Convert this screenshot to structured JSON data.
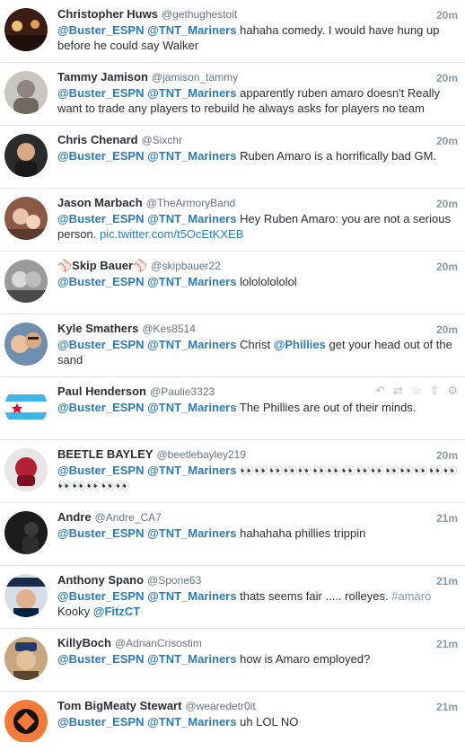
{
  "tweets": [
    {
      "name": "Christopher Huws",
      "handle": "@gethughestoit",
      "time": "20m",
      "m1": "@Buster_ESPN",
      "m2": "@TNT_Mariners",
      "text": "hahaha comedy. I would have hung up before he could say Walker"
    },
    {
      "name": "Tammy Jamison",
      "handle": "@jamison_tammy",
      "time": "20m",
      "m1": "@Buster_ESPN",
      "m2": "@TNT_Mariners",
      "text": "apparently ruben amaro doesn't Really want to trade any players to rebuild he always asks for players no team"
    },
    {
      "name": "Chris Chenard",
      "handle": "@Sixchr",
      "time": "20m",
      "m1": "@Buster_ESPN",
      "m2": "@TNT_Mariners",
      "text": "Ruben Amaro is a horrifically bad GM."
    },
    {
      "name": "Jason Marbach",
      "handle": "@TheArmoryBand",
      "time": "20m",
      "m1": "@Buster_ESPN",
      "m2": "@TNT_Mariners",
      "text": "Hey Ruben Amaro: you are not a serious person.",
      "link": "pic.twitter.com/t5OcEtKXEB"
    },
    {
      "name": "⚾Skip Bauer⚾",
      "handle": "@skipbauer22",
      "time": "20m",
      "m1": "@Buster_ESPN",
      "m2": "@TNT_Mariners",
      "text": "lolololololol"
    },
    {
      "name": "Kyle Smathers",
      "handle": "@Kes8514",
      "time": "20m",
      "m1": "@Buster_ESPN",
      "m2": "@TNT_Mariners",
      "text": "Christ",
      "m3": "@Phillies",
      "text2": "get your head out of the sand"
    },
    {
      "name": "Paul Henderson",
      "handle": "@Paulie3323",
      "time": "",
      "m1": "@Buster_ESPN",
      "m2": "@TNT_Mariners",
      "text": "The Phillies are out of their minds.",
      "actions": [
        "reply-icon",
        "retweet-icon",
        "favorite-icon",
        "share-icon",
        "more-icon"
      ]
    },
    {
      "name": "BEETLE BAYLEY",
      "handle": "@beetlebayley219",
      "time": "20m",
      "m1": "@Buster_ESPN",
      "m2": "@TNT_Mariners",
      "text": "👀👀👀👀👀👀👀👀👀👀👀👀👀👀👀👀👀👀👀👀"
    },
    {
      "name": "Andre",
      "handle": "@Andre_CA7",
      "time": "21m",
      "m1": "@Buster_ESPN",
      "m2": "@TNT_Mariners",
      "text": "hahahaha phillies trippin"
    },
    {
      "name": "Anthony Spano",
      "handle": "@Spone63",
      "time": "21m",
      "m1": "@Buster_ESPN",
      "m2": "@TNT_Mariners",
      "text": "thats seems fair .....  rolleyes.",
      "hashtag": "#amaro",
      "text2": "Kooky",
      "m3": "@FitzCT"
    },
    {
      "name": "KillyBoch",
      "handle": "@AdrianCrisostim",
      "time": "21m",
      "m1": "@Buster_ESPN",
      "m2": "@TNT_Mariners",
      "text": "how is Amaro employed?"
    },
    {
      "name": "Tom BigMeaty Stewart",
      "handle": "@wearedetr0it",
      "time": "21m",
      "m1": "@Buster_ESPN",
      "m2": "@TNT_Mariners",
      "text": "uh LOL NO"
    }
  ]
}
